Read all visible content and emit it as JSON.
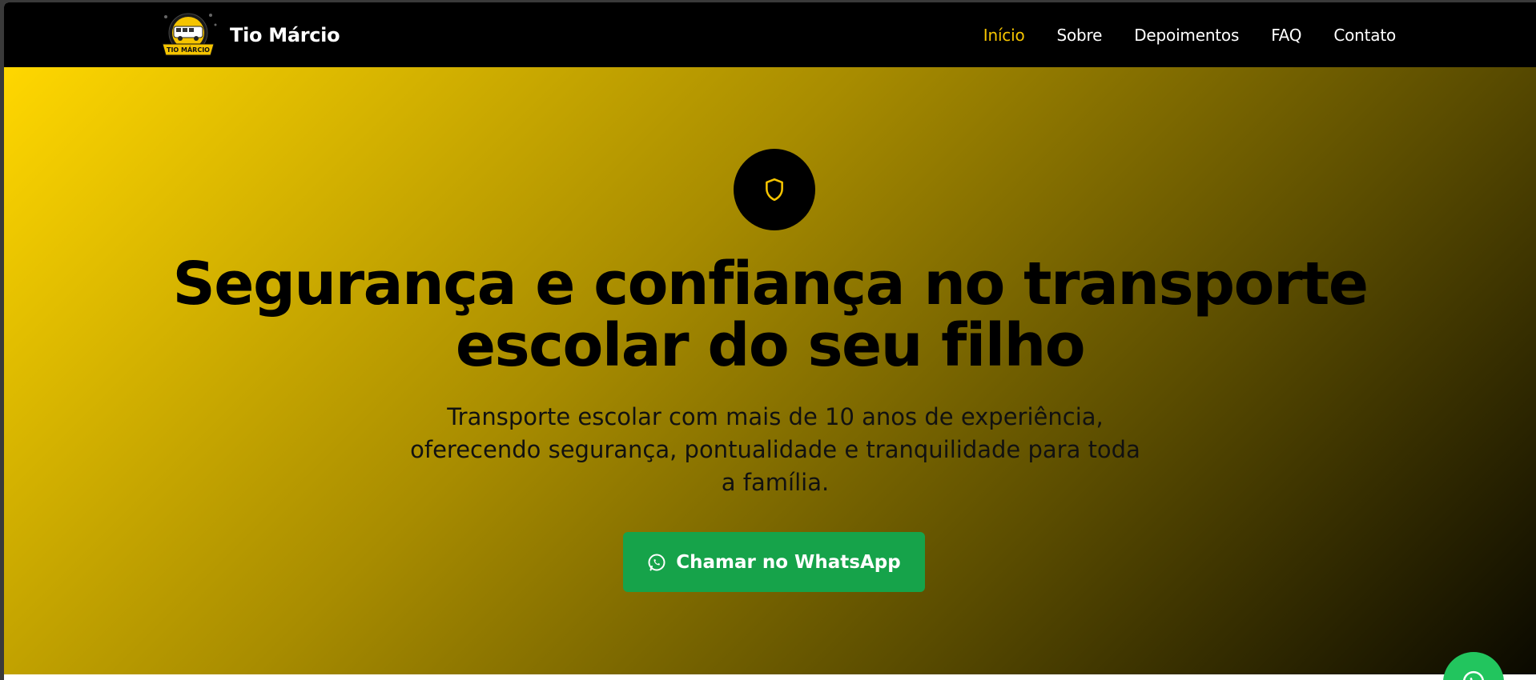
{
  "brand": {
    "name": "Tio Márcio",
    "logo_text": "TIO MÁRCIO"
  },
  "nav": {
    "items": [
      {
        "label": "Início",
        "active": true
      },
      {
        "label": "Sobre",
        "active": false
      },
      {
        "label": "Depoimentos",
        "active": false
      },
      {
        "label": "FAQ",
        "active": false
      },
      {
        "label": "Contato",
        "active": false
      }
    ]
  },
  "hero": {
    "icon": "shield-icon",
    "title_line1": "Segurança e confiança no transporte",
    "title_line2": "escolar do seu filho",
    "subtitle_line1": "Transporte escolar com mais de 10 anos de experiência,",
    "subtitle_line2": "oferecendo segurança, pontualidade e tranquilidade para toda",
    "subtitle_line3": "a família.",
    "cta_label": "Chamar no WhatsApp",
    "cta_icon": "whatsapp-icon"
  },
  "floating": {
    "icon": "whatsapp-icon"
  },
  "colors": {
    "nav_bg": "#000000",
    "accent": "#f5c400",
    "cta_bg": "#16a34a",
    "float_bg": "#22c55e",
    "gradient_start": "#ffd700",
    "gradient_end": "#0a0900"
  }
}
